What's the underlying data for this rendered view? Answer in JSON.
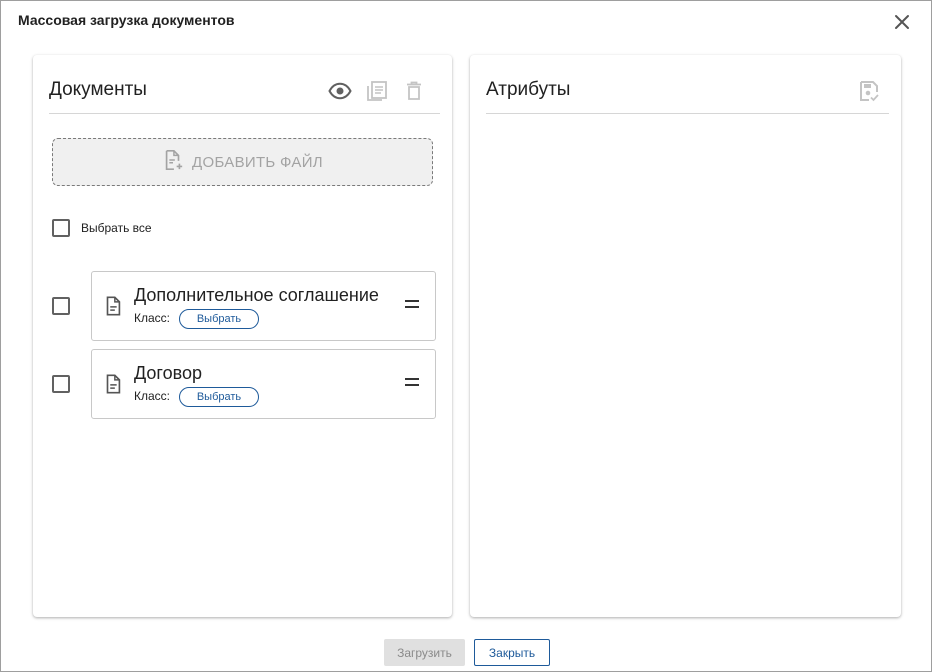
{
  "dialog": {
    "title": "Массовая загрузка документов"
  },
  "documents_panel": {
    "title": "Документы",
    "toolbar_icons": [
      "eye-icon",
      "list-view-icon",
      "delete-icon"
    ],
    "add_file_label": "ДОБАВИТЬ ФАЙЛ",
    "select_all_label": "Выбрать все",
    "items": [
      {
        "name": "Дополнительное соглашение",
        "class_label": "Класс:",
        "class_button": "Выбрать",
        "checked": false
      },
      {
        "name": "Договор",
        "class_label": "Класс:",
        "class_button": "Выбрать",
        "checked": false
      }
    ]
  },
  "attributes_panel": {
    "title": "Атрибуты",
    "toolbar_icons": [
      "save-icon"
    ]
  },
  "footer": {
    "upload_label": "Загрузить",
    "close_label": "Закрыть"
  },
  "colors": {
    "accent": "#1e5a9a",
    "disabled_text": "#a3a3a3",
    "disabled_bg": "#e0e0e0"
  }
}
